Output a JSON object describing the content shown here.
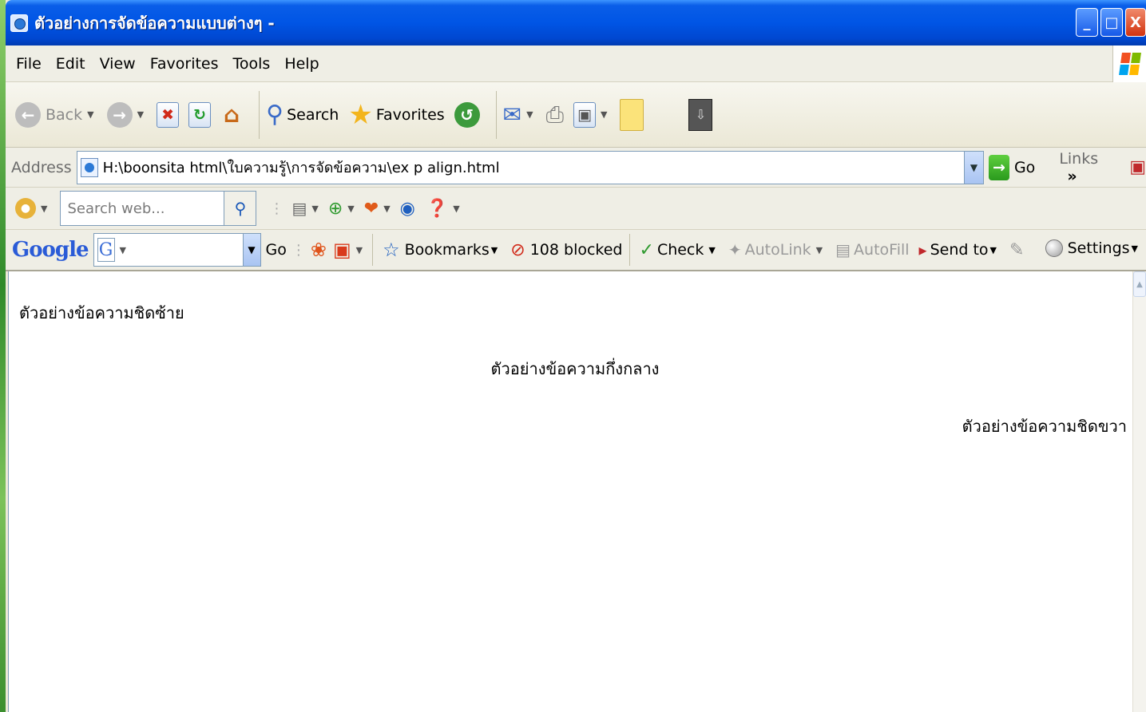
{
  "window": {
    "title": "ตัวอย่างการจัดข้อความแบบต่างๆ -",
    "buttons": {
      "minimize": "_",
      "maximize": "□",
      "close": "X"
    }
  },
  "menu": [
    "File",
    "Edit",
    "View",
    "Favorites",
    "Tools",
    "Help"
  ],
  "toolbar": {
    "back_label": "Back",
    "search_label": "Search",
    "favorites_label": "Favorites"
  },
  "address": {
    "label": "Address",
    "url": "H:\\boonsita html\\ใบความรู้\\การจัดข้อความ\\ex p align.html",
    "go_label": "Go",
    "links_label": "Links",
    "chevron": "»"
  },
  "searchbar": {
    "placeholder": "Search web..."
  },
  "googlebar": {
    "logo": "Google",
    "input_letter": "G",
    "go_label": "Go",
    "bookmarks_label": "Bookmarks",
    "blocked_label": "108 blocked",
    "check_label": "Check",
    "autolink_label": "AutoLink",
    "autofill_label": "AutoFill",
    "sendto_label": "Send to",
    "settings_label": "Settings"
  },
  "content": {
    "left_text": "ตัวอย่างข้อความชิดซ้าย",
    "center_text": "ตัวอย่างข้อความกึ่งกลาง",
    "right_text": "ตัวอย่างข้อความชิดขวา"
  },
  "colors": {
    "titlebar": "#0055e5",
    "chrome": "#ece9d8",
    "page_bg": "#ffffff"
  }
}
